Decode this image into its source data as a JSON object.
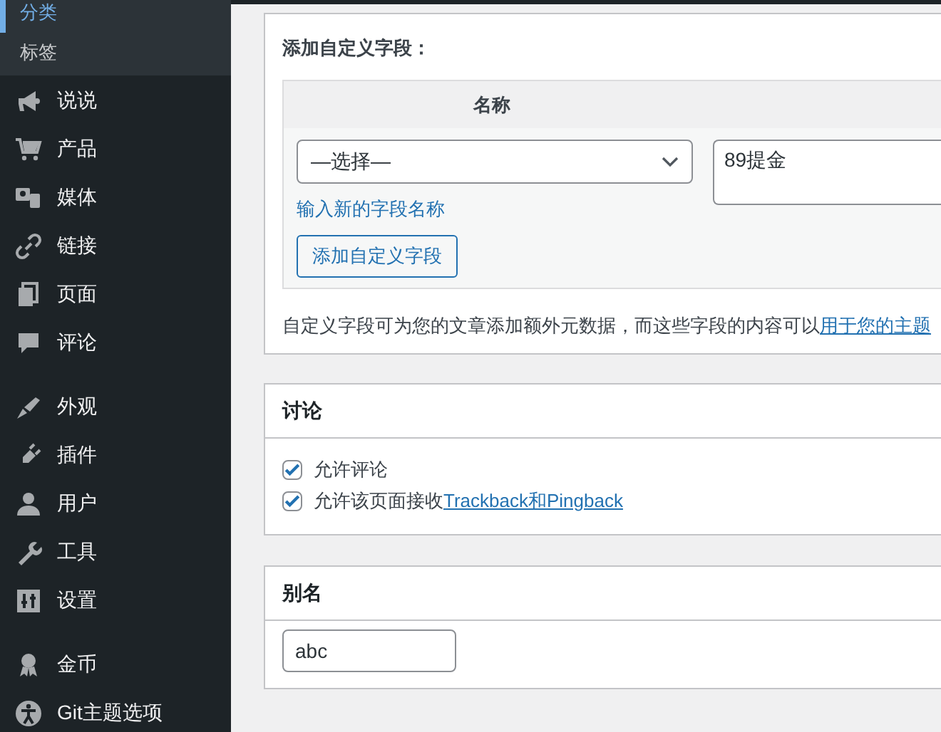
{
  "sidebar": {
    "submenu": [
      {
        "label": "分类",
        "selected": true
      },
      {
        "label": "标签",
        "selected": false
      }
    ],
    "groups": [
      {
        "items": [
          {
            "label": "说说"
          },
          {
            "label": "产品"
          },
          {
            "label": "媒体"
          },
          {
            "label": "链接"
          },
          {
            "label": "页面"
          },
          {
            "label": "评论"
          }
        ]
      },
      {
        "items": [
          {
            "label": "外观"
          },
          {
            "label": "插件"
          },
          {
            "label": "用户"
          },
          {
            "label": "工具"
          },
          {
            "label": "设置"
          }
        ]
      },
      {
        "items": [
          {
            "label": "金币"
          },
          {
            "label": "Git主题选项"
          }
        ]
      }
    ]
  },
  "custom_fields": {
    "heading": "添加自定义字段：",
    "column_header": "名称",
    "select": {
      "value": "—选择—"
    },
    "value_field": {
      "value": "89提金"
    },
    "new_name_link": "输入新的字段名称",
    "add_button": "添加自定义字段",
    "description": {
      "text": "自定义字段可为您的文章添加额外元数据，而这些字段的内容可以",
      "link": "用于您的主题"
    }
  },
  "discussion": {
    "title": "讨论",
    "options": [
      {
        "label": "允许评论",
        "checked": true
      },
      {
        "label": "允许该页面接收",
        "link": "Trackback和Pingback",
        "checked": true
      }
    ]
  },
  "slug": {
    "title": "别名",
    "value": "abc"
  }
}
